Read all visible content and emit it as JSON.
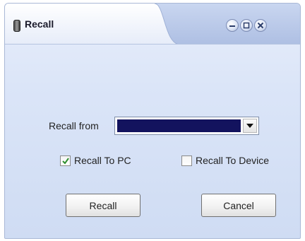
{
  "window": {
    "title": "Recall",
    "controls": [
      "minimize-icon",
      "maximize-icon",
      "close-icon"
    ]
  },
  "form": {
    "recall_from_label": "Recall from",
    "recall_from_value": "",
    "recall_to_pc_label": "Recall To PC",
    "recall_to_pc_checked": true,
    "recall_to_device_label": "Recall To Device",
    "recall_to_device_checked": false
  },
  "buttons": {
    "recall_label": "Recall",
    "cancel_label": "Cancel"
  },
  "colors": {
    "dropdown_selection": "#13135e",
    "checkmark": "#2f8f2f"
  }
}
